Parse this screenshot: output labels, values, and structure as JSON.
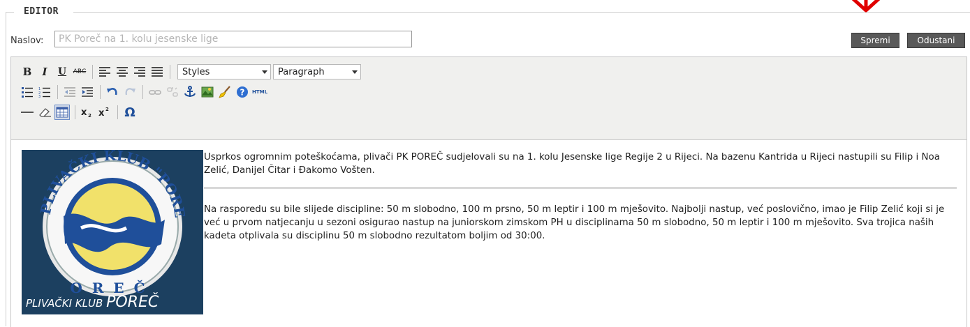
{
  "legend": "EDITOR",
  "title_field": {
    "label": "Naslov:",
    "placeholder": "PK Poreč na 1. kolu jesenske lige"
  },
  "buttons": {
    "save": "Spremi",
    "cancel": "Odustani"
  },
  "toolbar": {
    "styles_value": "Styles",
    "format_value": "Paragraph",
    "html_label": "HTML",
    "bold": "B",
    "italic": "I",
    "underline": "U",
    "strike": "ABC",
    "omega": "Ω"
  },
  "content": {
    "logo_caption_small": "PLIVAČKI KLUB",
    "logo_caption_big": "POREČ",
    "logo_ring_text": "PLIVAČKI KLUB \"POREČ\"",
    "paragraph1": "Usprkos ogromnim poteškoćama, plivači PK POREČ sudjelovali su na 1. kolu Jesenske lige Regije 2 u Rijeci. Na bazenu Kantrida u Rijeci nastupili su Filip i Noa Zelić, Danijel Čitar i Đakomo Vošten.",
    "paragraph2": "Na rasporedu su bile slijede discipline: 50 m slobodno, 100 m prsno, 50 m leptir i 100 m mješovito. Najbolji nastup, već poslovično, imao je Filip Zelić koji si je već u prvom natjecanju u sezoni osigurao nastup na juniorskom zimskom PH u disciplinama 50 m slobodno, 50 m leptir i 100 m mješovito. Sva trojica naših kadeta otplivala su disciplinu 50 m slobodno rezultatom boljim od 30:00."
  },
  "colors": {
    "button_bg": "#595959",
    "toolbar_bg": "#f0f0ee",
    "logo_bg": "#1c4060",
    "arrow": "#e00000"
  }
}
